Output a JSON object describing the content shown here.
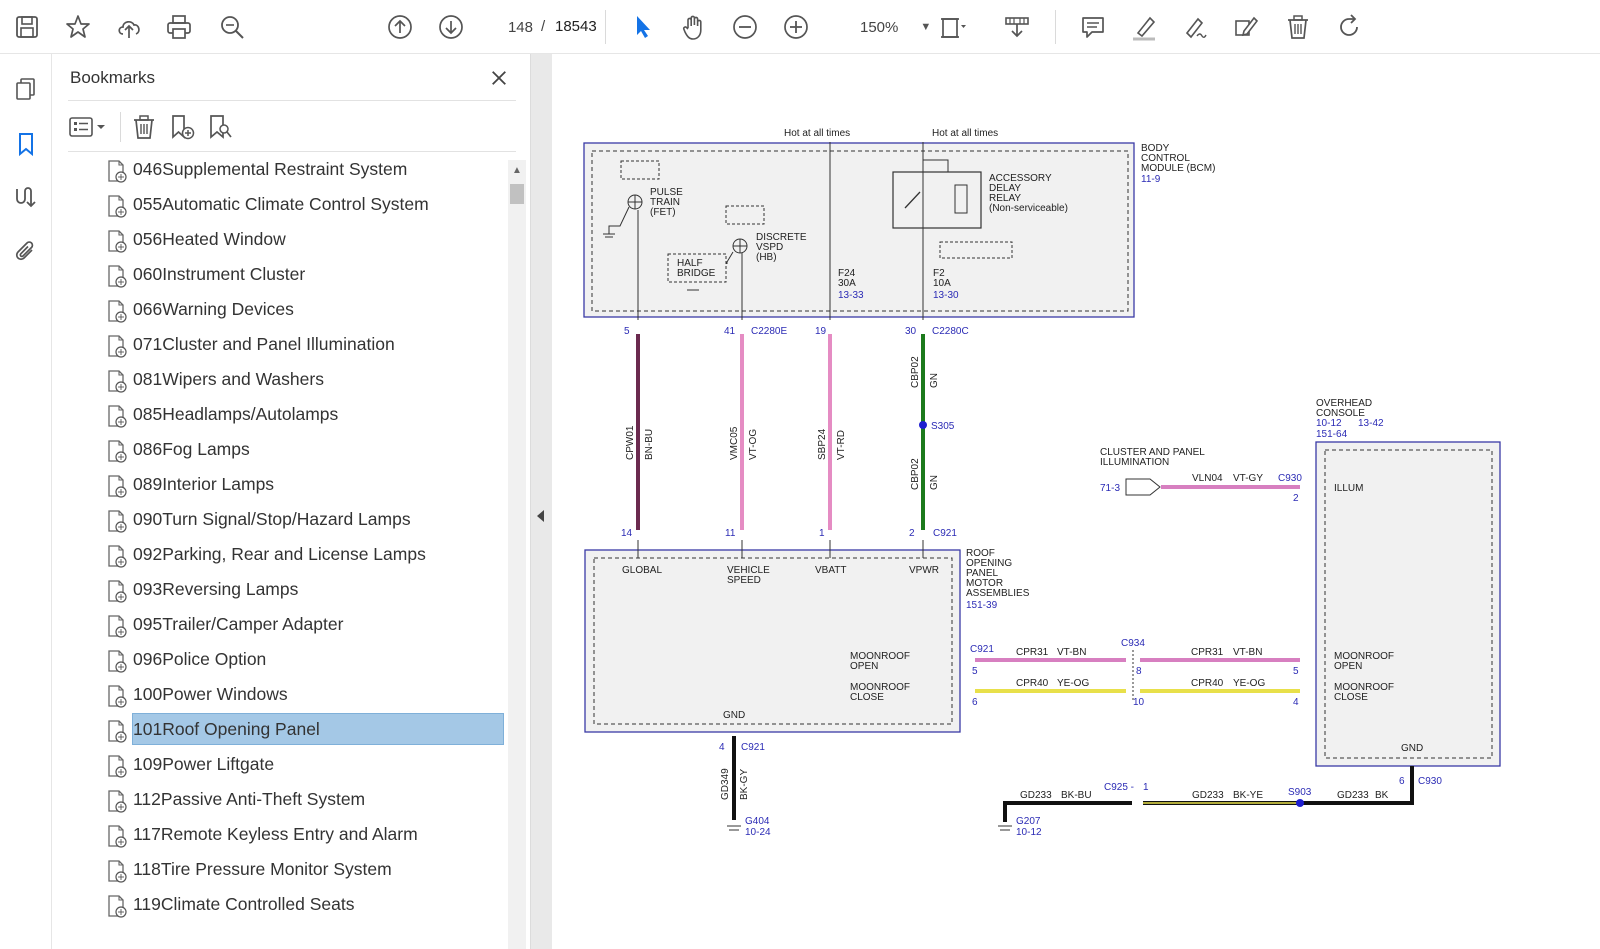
{
  "toolbar": {
    "page_current": "148",
    "page_separator": "/",
    "page_total": "18543",
    "zoom": "150%"
  },
  "bookmarks": {
    "title": "Bookmarks",
    "items": [
      {
        "label": "046Supplemental Restraint System"
      },
      {
        "label": "055Automatic Climate Control System"
      },
      {
        "label": "056Heated Window"
      },
      {
        "label": "060Instrument Cluster"
      },
      {
        "label": "066Warning Devices"
      },
      {
        "label": "071Cluster and Panel Illumination"
      },
      {
        "label": "081Wipers and Washers"
      },
      {
        "label": "085Headlamps/Autolamps"
      },
      {
        "label": "086Fog Lamps"
      },
      {
        "label": "089Interior Lamps"
      },
      {
        "label": "090Turn Signal/Stop/Hazard Lamps"
      },
      {
        "label": "092Parking, Rear and License Lamps"
      },
      {
        "label": "093Reversing Lamps"
      },
      {
        "label": "095Trailer/Camper Adapter"
      },
      {
        "label": "096Police Option"
      },
      {
        "label": "100Power Windows"
      },
      {
        "label": "101Roof Opening Panel",
        "selected": true
      },
      {
        "label": "109Power Liftgate"
      },
      {
        "label": "112Passive Anti-Theft System"
      },
      {
        "label": "117Remote Keyless Entry and Alarm"
      },
      {
        "label": "118Tire Pressure Monitor System"
      },
      {
        "label": "119Climate Controlled Seats"
      }
    ]
  },
  "colors": {
    "accent": "#1473e6",
    "selection": "#a4c8e6",
    "wire_bn_bu": "#6b2a4f",
    "wire_vt_og": "#e58cc3",
    "wire_vt_rd": "#e58cc3",
    "wire_gn": "#1c7a1c",
    "wire_vt_bn": "#d77fc0",
    "wire_ye_og": "#e8e04a",
    "wire_bk": "#111111",
    "label_blue": "#2b2bb5"
  },
  "diagram": {
    "hot1": "Hot at all times",
    "hot2": "Hot at all times",
    "bcm_name": "BODY\nCONTROL\nMODULE (BCM)",
    "bcm_ref": "11-9",
    "pulse_train": "PULSE\nTRAIN\n(FET)",
    "half_bridge": "HALF\nBRIDGE",
    "discrete": "DISCRETE\nVSPD\n(HB)",
    "relay": "ACCESSORY\nDELAY\nRELAY\n(Non-serviceable)",
    "f24": "F24\n30A",
    "f24_ref": "13-33",
    "f2": "F2\n10A",
    "f2_ref": "13-30",
    "pin5": "5",
    "pin41": "41",
    "c2280e": "C2280E",
    "pin19": "19",
    "pin30": "30",
    "c2280c": "C2280C",
    "w1_code": "CPW01",
    "w1_color": "BN-BU",
    "w2_code": "VMC05",
    "w2_color": "VT-OG",
    "w3_code": "SBP24",
    "w3_color": "VT-RD",
    "w4_code_a": "CBP02",
    "w4_color_a": "GN",
    "w4_code_b": "CBP02",
    "w4_color_b": "GN",
    "s305": "S305",
    "pin14": "14",
    "pin11": "11",
    "pin1": "1",
    "pin2": "2",
    "c921": "C921",
    "rop_name": "ROOF\nOPENING\nPANEL\nMOTOR\nASSEMBLIES",
    "rop_ref": "151-39",
    "global": "GLOBAL",
    "vehicle_speed": "VEHICLE\nSPEED",
    "vbatt": "VBATT",
    "vpwr": "VPWR",
    "moonroof_open": "MOONROOF\nOPEN",
    "moonroof_close": "MOONROOF\nCLOSE",
    "gnd": "GND",
    "c921_b": "C921",
    "pin5b": "5",
    "pin6b": "6",
    "cpr31": "CPR31",
    "vt_bn": "VT-BN",
    "cpr40": "CPR40",
    "ye_og": "YE-OG",
    "c934": "C934",
    "pin8": "8",
    "pin10": "10",
    "cpr31b": "CPR31",
    "vt_bn_b": "VT-BN",
    "cpr40b": "CPR40",
    "ye_og_b": "YE-OG",
    "pin5c": "5",
    "pin4c": "4",
    "overhead": "OVERHEAD\nCONSOLE",
    "overhead_ref1": "10-12",
    "overhead_ref2": "13-42",
    "overhead_ref3": "151-64",
    "illum": "ILLUM",
    "moonroof_open_b": "MOONROOF\nOPEN",
    "moonroof_close_b": "MOONROOF\nCLOSE",
    "gnd_b": "GND",
    "cluster": "CLUSTER AND PANEL\nILLUMINATION",
    "ref71": "71-3",
    "vln04": "VLN04",
    "vt_gy": "VT-GY",
    "c930": "C930",
    "pin2c": "2",
    "pin4d": "4",
    "c921_c": "C921",
    "gd349": "GD349",
    "bk_gy": "BK-GY",
    "g404": "G404",
    "g404_ref": "10-24",
    "gd233a": "GD233",
    "bk_bu": "BK-BU",
    "c925": "C925 -",
    "pin1c": "1",
    "gd233b": "GD233",
    "bk_ye": "BK-YE",
    "s903": "S903",
    "gd233c": "GD233",
    "bk": "BK",
    "pin6c": "6",
    "c930b": "C930",
    "g207": "G207",
    "g207_ref": "10-12"
  }
}
